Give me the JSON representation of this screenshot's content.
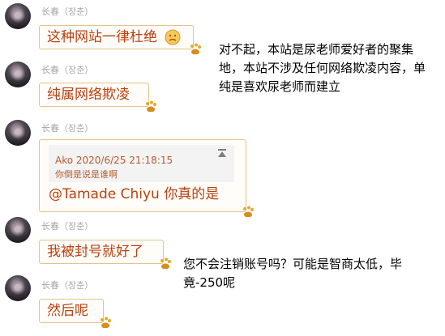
{
  "messages": [
    {
      "sender": "长春（장춘）",
      "text": "这种网站一律杜绝"
    },
    {
      "sender": "长春（장춘）",
      "text": "纯属网络欺凌"
    },
    {
      "sender": "长春（장춘）",
      "quote_meta": "Ako  2020/6/25 21:18:15",
      "quote_body": "你倒是说是谁啊",
      "text": "@Tamade Chiyu 你真的是"
    },
    {
      "sender": "长春（장춘）",
      "text": "我被封号就好了"
    },
    {
      "sender": "长春（장춘）",
      "text": "然后呢"
    }
  ],
  "annotations": {
    "first": {
      "line1": "对不起，本站是尿老师爱好者的聚集",
      "line2": "地，本站不涉及任何网络欺凌内容，单",
      "line3": "纯是喜欢尿老师而建立"
    },
    "second": {
      "line1": "您不会注销账号吗？可能是智商太低，毕",
      "line2": "竟-250呢"
    }
  },
  "colors": {
    "bubble_border": "#e6c387",
    "bubble_text": "#b7410e",
    "sender_text": "#a6a6a6"
  }
}
